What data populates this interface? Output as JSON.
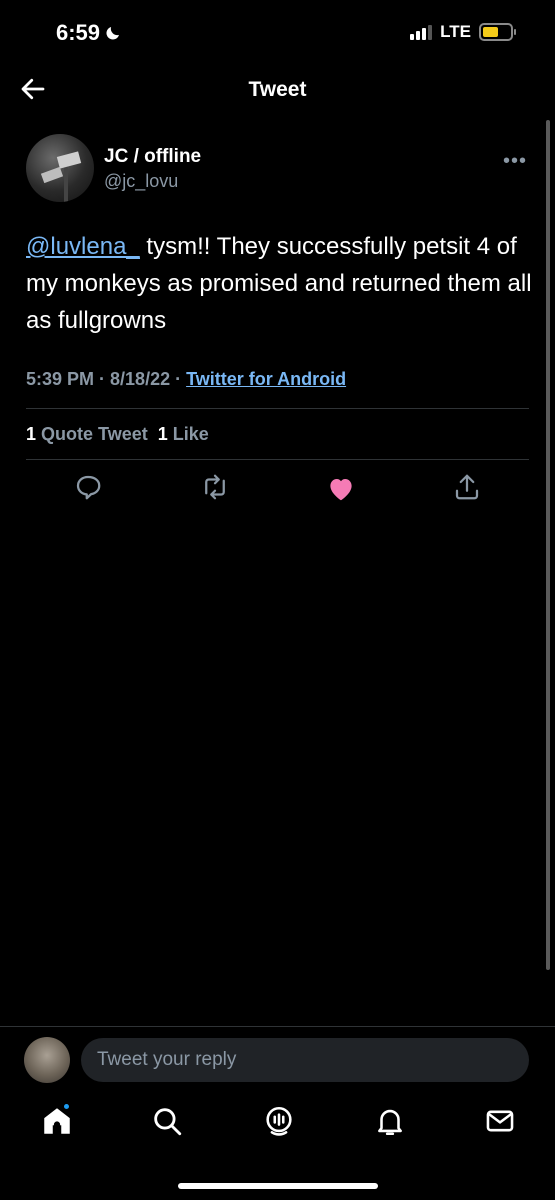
{
  "status_bar": {
    "time": "6:59",
    "network": "LTE"
  },
  "header": {
    "title": "Tweet"
  },
  "tweet": {
    "author_name": "JC / offline",
    "author_handle": "@jc_lovu",
    "mention": "@luvlena_",
    "text": " tysm!! They successfully petsit 4 of my monkeys as promised and returned them all as fullgrowns",
    "time": "5:39 PM",
    "date": "8/18/22",
    "source": "Twitter for Android",
    "quote_count": "1",
    "quote_label": "Quote Tweet",
    "like_count": "1",
    "like_label": "Like",
    "liked": true,
    "like_color": "#f91880"
  },
  "reply": {
    "placeholder": "Tweet your reply"
  },
  "icons": [
    "back-arrow-icon",
    "more-icon",
    "reply-icon",
    "retweet-icon",
    "like-icon",
    "share-icon",
    "home-icon",
    "search-icon",
    "spaces-icon",
    "notifications-icon",
    "messages-icon"
  ]
}
